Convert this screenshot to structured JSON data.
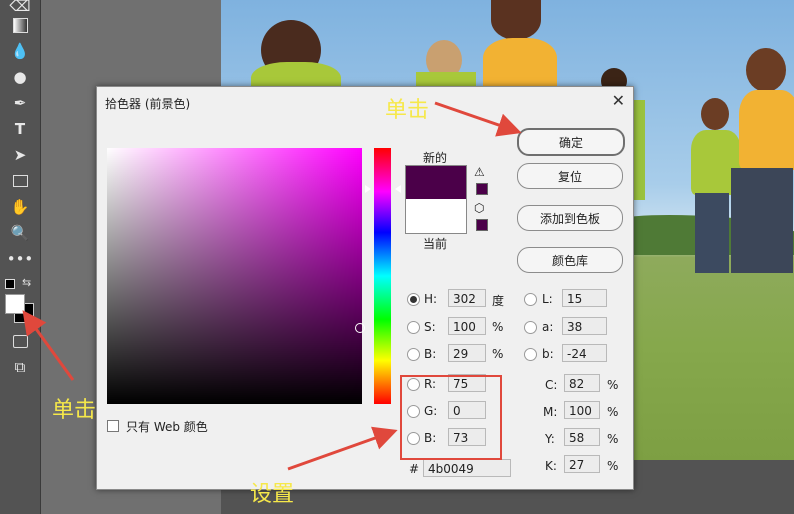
{
  "annotations": {
    "click_top": "单击",
    "click_left": "单击",
    "set": "设置"
  },
  "dialog": {
    "title": "拾色器 (前景色)",
    "close": "✕",
    "label_new": "新的",
    "label_current": "当前",
    "buttons": {
      "ok": "确定",
      "reset": "复位",
      "add_swatch": "添加到色板",
      "color_library": "颜色库"
    },
    "web_only": "只有 Web 颜色",
    "fields": {
      "H": {
        "label": "H:",
        "value": "302",
        "unit": "度"
      },
      "S": {
        "label": "S:",
        "value": "100",
        "unit": "%"
      },
      "B": {
        "label": "B:",
        "value": "29",
        "unit": "%"
      },
      "R": {
        "label": "R:",
        "value": "75"
      },
      "G": {
        "label": "G:",
        "value": "0"
      },
      "Bb": {
        "label": "B:",
        "value": "73"
      },
      "L": {
        "label": "L:",
        "value": "15"
      },
      "a": {
        "label": "a:",
        "value": "38"
      },
      "b": {
        "label": "b:",
        "value": "-24"
      },
      "C": {
        "label": "C:",
        "value": "82",
        "unit": "%"
      },
      "M": {
        "label": "M:",
        "value": "100",
        "unit": "%"
      },
      "Y": {
        "label": "Y:",
        "value": "58",
        "unit": "%"
      },
      "K": {
        "label": "K:",
        "value": "27",
        "unit": "%"
      },
      "hex_label": "#",
      "hex": "4b0049"
    }
  },
  "colors": {
    "new_color": "#4b0049",
    "current_color": "#ffffff",
    "annotation": "#f6e84a",
    "arrow": "#e0483c"
  },
  "tools": [
    "eraser-icon",
    "gradient-icon",
    "blur-icon",
    "dodge-icon",
    "pen-icon",
    "type-icon",
    "path-select-icon",
    "rectangle-icon",
    "hand-icon",
    "zoom-icon",
    "more-icon"
  ]
}
